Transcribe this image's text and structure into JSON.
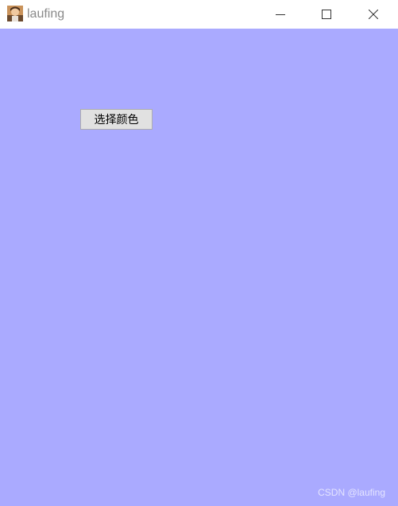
{
  "window": {
    "title": "laufing",
    "icon": "app-avatar-icon",
    "controls": {
      "minimize_icon": "minimize-icon",
      "maximize_icon": "maximize-icon",
      "close_icon": "close-icon"
    }
  },
  "content": {
    "background_color": "#aaaaff",
    "choose_color_button": "选择颜色"
  },
  "watermark": "CSDN @laufing"
}
